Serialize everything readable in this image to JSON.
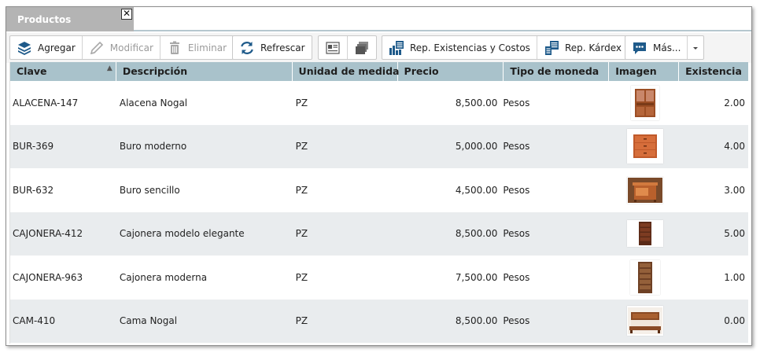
{
  "window": {
    "tab_title": "Productos",
    "close_glyph": "✕"
  },
  "toolbar": {
    "add": "Agregar",
    "edit": "Modificar",
    "delete": "Eliminar",
    "refresh": "Refrescar",
    "rep_stock": "Rep. Existencias y Costos",
    "rep_kardex": "Rep. Kárdex",
    "more": "Más..."
  },
  "columns": [
    "Clave",
    "Descripción",
    "Unidad de medida",
    "Precio",
    "Tipo de moneda",
    "Imagen",
    "Existencia"
  ],
  "sort_indicator": "▲",
  "rows": [
    {
      "clave": "ALACENA-147",
      "descripcion": "Alacena Nogal",
      "unidad": "PZ",
      "precio": "8,500.00",
      "moneda": "Pesos",
      "imagen": "cupboard-image",
      "existencia": "2.00"
    },
    {
      "clave": "BUR-369",
      "descripcion": "Buro moderno",
      "unidad": "PZ",
      "precio": "5,000.00",
      "moneda": "Pesos",
      "imagen": "nightstand-modern-image",
      "existencia": "4.00"
    },
    {
      "clave": "BUR-632",
      "descripcion": "Buro sencillo",
      "unidad": "PZ",
      "precio": "4,500.00",
      "moneda": "Pesos",
      "imagen": "nightstand-simple-image",
      "existencia": "3.00"
    },
    {
      "clave": "CAJONERA-412",
      "descripcion": "Cajonera modelo elegante",
      "unidad": "PZ",
      "precio": "8,500.00",
      "moneda": "Pesos",
      "imagen": "dresser-elegant-image",
      "existencia": "5.00"
    },
    {
      "clave": "CAJONERA-963",
      "descripcion": "Cajonera moderna",
      "unidad": "PZ",
      "precio": "7,500.00",
      "moneda": "Pesos",
      "imagen": "dresser-modern-image",
      "existencia": "1.00"
    },
    {
      "clave": "CAM-410",
      "descripcion": "Cama Nogal",
      "unidad": "PZ",
      "precio": "8,500.00",
      "moneda": "Pesos",
      "imagen": "bed-image",
      "existencia": "0.00"
    }
  ],
  "colors": {
    "header_bg": "#a9c2cb",
    "tab_bg": "#b4b4b4",
    "row_alt_bg": "#e9ecee",
    "icon_blue": "#1e5a8a",
    "wood": "#a0522d"
  }
}
